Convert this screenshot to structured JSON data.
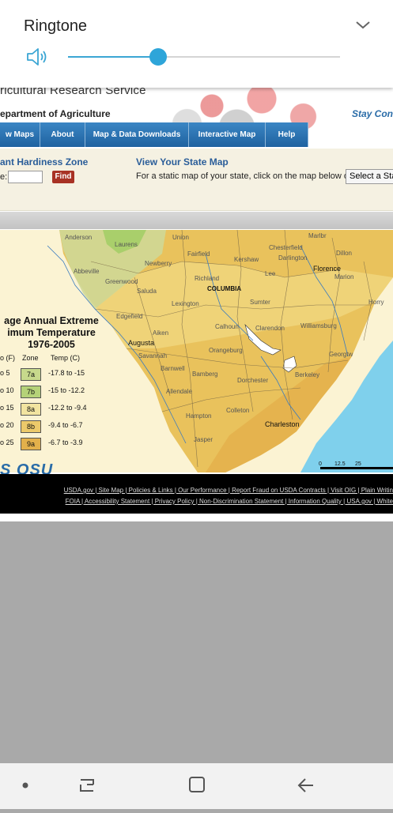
{
  "volume_panel": {
    "title": "Ringtone",
    "level": 0.33,
    "accent_color": "#2ea5d9",
    "icons": [
      "speaker-icon",
      "chevron-down-icon"
    ]
  },
  "website": {
    "agency": "ricultural Research Service",
    "department": "epartment of Agriculture",
    "stay_connected": "Stay Con",
    "nav": [
      "w Maps",
      "About",
      "Map & Data Downloads",
      "Interactive Map",
      "Help"
    ],
    "hardiness_zone_title": "ant Hardiness Zone",
    "zip_label": "e:",
    "zip_value": "",
    "find_label": "Find",
    "state_map_title": "View Your State Map",
    "state_map_desc": "For a static map of your state, click on the map below or",
    "state_select": "Select a Sta"
  },
  "map": {
    "cities": [
      "Anderson",
      "Laurens",
      "Union",
      "Abbeville",
      "Newberry",
      "Fairfield",
      "Kershaw",
      "Chesterfield",
      "Marlbr",
      "Darlington",
      "Dillon",
      "Florence",
      "Marion",
      "Greenwood",
      "Saluda",
      "Richland",
      "COLUMBIA",
      "Lee",
      "Lexington",
      "Sumter",
      "Horry",
      "Edgefield",
      "Calhoun",
      "Clarendon",
      "Williamsburg",
      "Aiken",
      "Orangeburg",
      "Georgtw",
      "Augusta",
      "Barnwell",
      "Bamberg",
      "Dorchester",
      "Berkeley",
      "Allendale",
      "Colleton",
      "Charleston",
      "Hampton",
      "Jasper",
      "Savannah"
    ],
    "legend_title_lines": [
      "age Annual Extreme",
      "imum Temperature",
      "1976-2005"
    ],
    "legend_header": {
      "f": "o (F)",
      "zone": "Zone",
      "c": "Temp (C)"
    },
    "legend_rows": [
      {
        "f": "o 5",
        "zone": "7a",
        "c": "-17.8 to -15",
        "color": "#c7d98c"
      },
      {
        "f": "o 10",
        "zone": "7b",
        "c": "-15 to -12.2",
        "color": "#b5d278"
      },
      {
        "f": "o 15",
        "zone": "8a",
        "c": "-12.2 to -9.4",
        "color": "#f2e4a0"
      },
      {
        "f": "o 20",
        "zone": "8b",
        "c": "-9.4 to -6.7",
        "color": "#ecc96a"
      },
      {
        "f": "o 25",
        "zone": "9a",
        "c": "-6.7 to -3.9",
        "color": "#e3b04b"
      }
    ],
    "scale": [
      "0",
      "12.5",
      "25"
    ],
    "logo": "S OSU"
  },
  "footer": {
    "line1": "USDA.gov | Site Map | Policies & Links | Our Performance | Report Fraud on USDA Contracts | Visit OIG | Plain Writin",
    "line2": "FOIA | Accessibility Statement | Privacy Policy | Non-Discrimination Statement | Information Quality | USA.gov | White"
  },
  "system_nav": {
    "icons": [
      "dot-icon",
      "recent-apps-icon",
      "home-icon",
      "back-icon"
    ]
  }
}
